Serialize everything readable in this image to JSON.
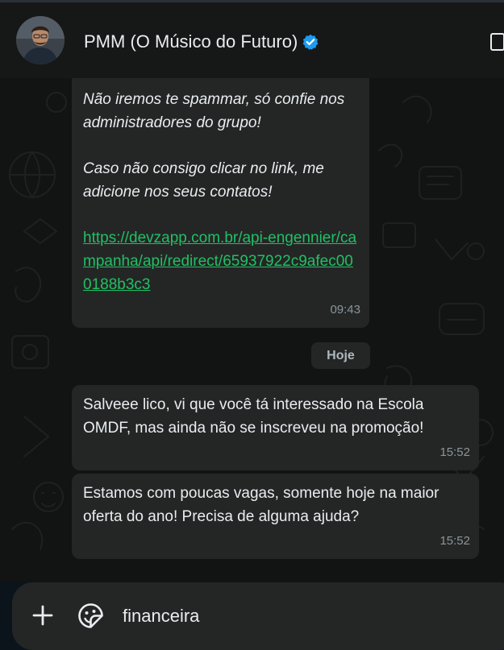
{
  "header": {
    "contact_name": "PMM (O Músico do Futuro)",
    "avatar_icon": "person-photo",
    "verified_icon": "verified-badge-icon",
    "verified_color": "#1da1f2"
  },
  "messages": [
    {
      "lines": [
        "Não iremos te spammar, só confie nos administradores do grupo!",
        "Caso não consigo clicar no link, me adicione nos seus contatos!"
      ],
      "link": "https://devzapp.com.br/api-engennier/campanha/api/redirect/65937922c9afec000188b3c3",
      "time": "09:43"
    },
    {
      "text": "Salveee lico, vi que você tá interessado na Escola OMDF, mas ainda não se inscreveu na promoção!",
      "time": "15:52"
    },
    {
      "text": "Estamos com poucas vagas, somente hoje na maior oferta do ano! Precisa de alguma ajuda?",
      "time": "15:52"
    }
  ],
  "day_divider": "Hoje",
  "composer": {
    "value": "financeira",
    "plus_icon": "plus-icon",
    "sticker_icon": "sticker-icon"
  },
  "colors": {
    "bubble": "#242626",
    "link": "#21c063",
    "background": "#121313"
  }
}
